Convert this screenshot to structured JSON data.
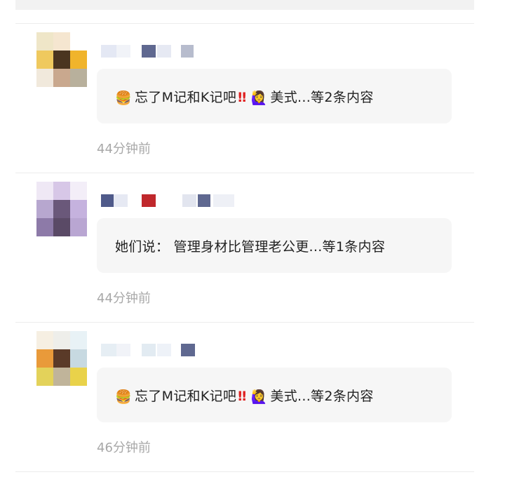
{
  "comments": [
    {
      "segments": [
        "忘了M记和K记吧",
        "美式...等2条内容"
      ],
      "time": "44分钟前",
      "icons": [
        "hamburger-icon",
        "double-exclamation-icon",
        "woman-raising-hand-icon"
      ]
    },
    {
      "text": "她们说： 管理身材比管理老公更...等1条内容",
      "time": "44分钟前"
    },
    {
      "segments": [
        "忘了M记和K记吧",
        "美式...等2条内容"
      ],
      "time": "46分钟前",
      "icons": [
        "hamburger-icon",
        "double-exclamation-icon",
        "woman-raising-hand-icon"
      ]
    }
  ]
}
